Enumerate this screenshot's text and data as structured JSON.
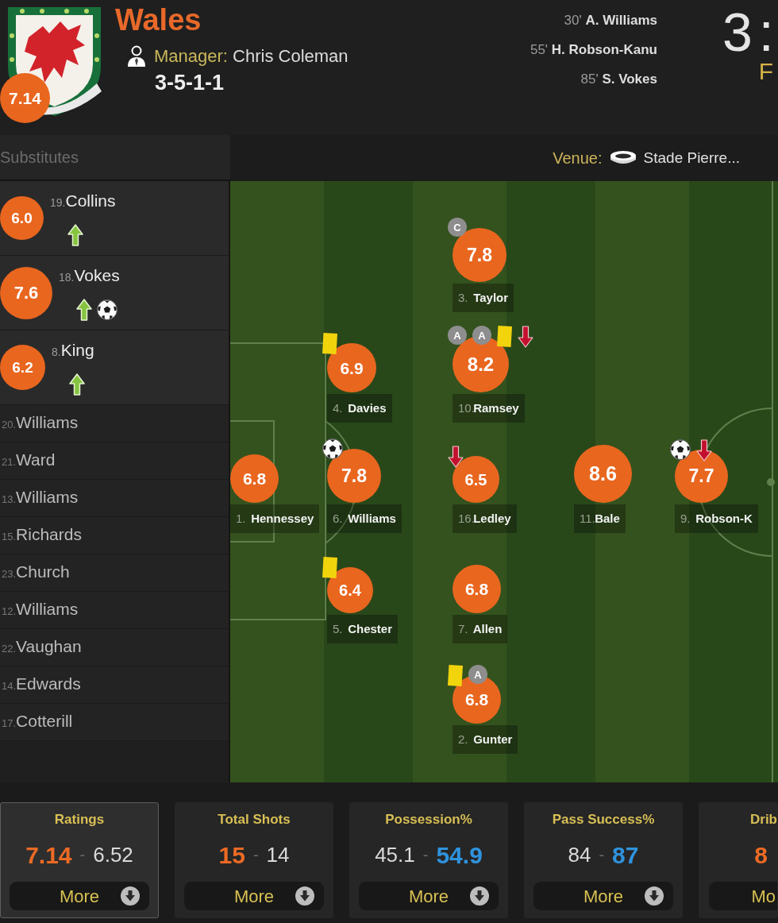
{
  "team": {
    "name": "Wales",
    "rating": "7.14",
    "manager_label": "Manager:",
    "manager": "Chris Coleman",
    "formation": "3-5-1-1"
  },
  "goals": [
    {
      "minute": "30'",
      "player": "A. Williams"
    },
    {
      "minute": "55'",
      "player": "H. Robson-Kanu"
    },
    {
      "minute": "85'",
      "player": "S. Vokes"
    }
  ],
  "score": {
    "home": "3",
    "separator": ":",
    "status": "F"
  },
  "substitutes": {
    "title": "Substitutes",
    "players": [
      {
        "kind": "played",
        "rating": "6.0",
        "number": "19.",
        "name": "Collins",
        "events": [
          {
            "kind": "sub-on"
          }
        ]
      },
      {
        "kind": "played",
        "rating": "7.6",
        "number": "18.",
        "name": "Vokes",
        "events": [
          {
            "kind": "sub-on"
          },
          {
            "kind": "goal"
          }
        ]
      },
      {
        "kind": "played",
        "rating": "6.2",
        "number": "8.",
        "name": "King",
        "events": [
          {
            "kind": "sub-on"
          }
        ]
      },
      {
        "kind": "unused",
        "number": "20.",
        "name": "Williams"
      },
      {
        "kind": "unused",
        "number": "21.",
        "name": "Ward"
      },
      {
        "kind": "unused",
        "number": "13.",
        "name": "Williams"
      },
      {
        "kind": "unused",
        "number": "15.",
        "name": "Richards"
      },
      {
        "kind": "unused",
        "number": "23.",
        "name": "Church"
      },
      {
        "kind": "unused",
        "number": "12.",
        "name": "Williams"
      },
      {
        "kind": "unused",
        "number": "22.",
        "name": "Vaughan"
      },
      {
        "kind": "unused",
        "number": "14.",
        "name": "Edwards"
      },
      {
        "kind": "unused",
        "number": "17.",
        "name": "Cotterill"
      }
    ]
  },
  "venue": {
    "label": "Venue:",
    "name": "Stade Pierre..."
  },
  "pitch": {
    "lines": [
      {
        "players": [
          {
            "rating": "6.8",
            "number": "1.",
            "name": "Hennessey"
          }
        ]
      },
      {
        "players": [
          {
            "rating": "6.9",
            "number": "4.",
            "name": "Davies",
            "events": [
              {
                "kind": "booking"
              }
            ]
          },
          {
            "rating": "7.8",
            "number": "6.",
            "name": "Williams",
            "events": [
              {
                "kind": "goal"
              }
            ]
          },
          {
            "rating": "6.4",
            "number": "5.",
            "name": "Chester",
            "events": [
              {
                "kind": "booking"
              }
            ]
          }
        ]
      },
      {
        "players": [
          {
            "rating": "7.8",
            "number": "3.",
            "name": "Taylor",
            "events": [
              {
                "kind": "badge",
                "label": "C"
              }
            ]
          },
          {
            "rating": "8.2",
            "number": "10.",
            "name": "Ramsey",
            "events": [
              {
                "kind": "badge",
                "label": "A"
              },
              {
                "kind": "badge",
                "label": "A"
              },
              {
                "kind": "booking"
              },
              {
                "kind": "sub-off"
              }
            ]
          },
          {
            "rating": "6.5",
            "number": "16.",
            "name": "Ledley",
            "events": [
              {
                "kind": "sub-off"
              }
            ]
          },
          {
            "rating": "6.8",
            "number": "7.",
            "name": "Allen"
          },
          {
            "rating": "6.8",
            "number": "2.",
            "name": "Gunter",
            "events": [
              {
                "kind": "booking"
              },
              {
                "kind": "badge",
                "label": "A"
              }
            ]
          }
        ]
      },
      {
        "players": [
          {
            "rating": "8.6",
            "number": "11.",
            "name": "Bale"
          }
        ]
      },
      {
        "players": [
          {
            "rating": "7.7",
            "number": "9.",
            "name": "Robson-K",
            "events": [
              {
                "kind": "goal"
              },
              {
                "kind": "sub-off"
              }
            ]
          }
        ]
      }
    ]
  },
  "stats": [
    {
      "title": "Ratings",
      "selected": true,
      "values": [
        {
          "text": "7.14",
          "leading": true
        },
        {
          "text": "6.52",
          "leading": false
        }
      ],
      "separator": "-",
      "more": {
        "label": "More",
        "icon": true
      }
    },
    {
      "title": "Total Shots",
      "selected": false,
      "values": [
        {
          "text": "15",
          "leading": true
        },
        {
          "text": "14",
          "leading": false
        }
      ],
      "separator": "-",
      "more": {
        "label": "More",
        "icon": true
      }
    },
    {
      "title": "Possession%",
      "selected": false,
      "values": [
        {
          "text": "45.1",
          "leading": false
        },
        {
          "text": "54.9",
          "leading": true
        }
      ],
      "separator": "-",
      "more": {
        "label": "More",
        "icon": true
      }
    },
    {
      "title": "Pass Success%",
      "selected": false,
      "values": [
        {
          "text": "84",
          "leading": false
        },
        {
          "text": "87",
          "leading": true
        }
      ],
      "separator": "-",
      "more": {
        "label": "More",
        "icon": true
      }
    },
    {
      "title": "Drib",
      "selected": false,
      "values": [
        {
          "text": "8",
          "leading": true
        }
      ],
      "more": {
        "label": "Mo",
        "icon": false
      }
    }
  ]
}
